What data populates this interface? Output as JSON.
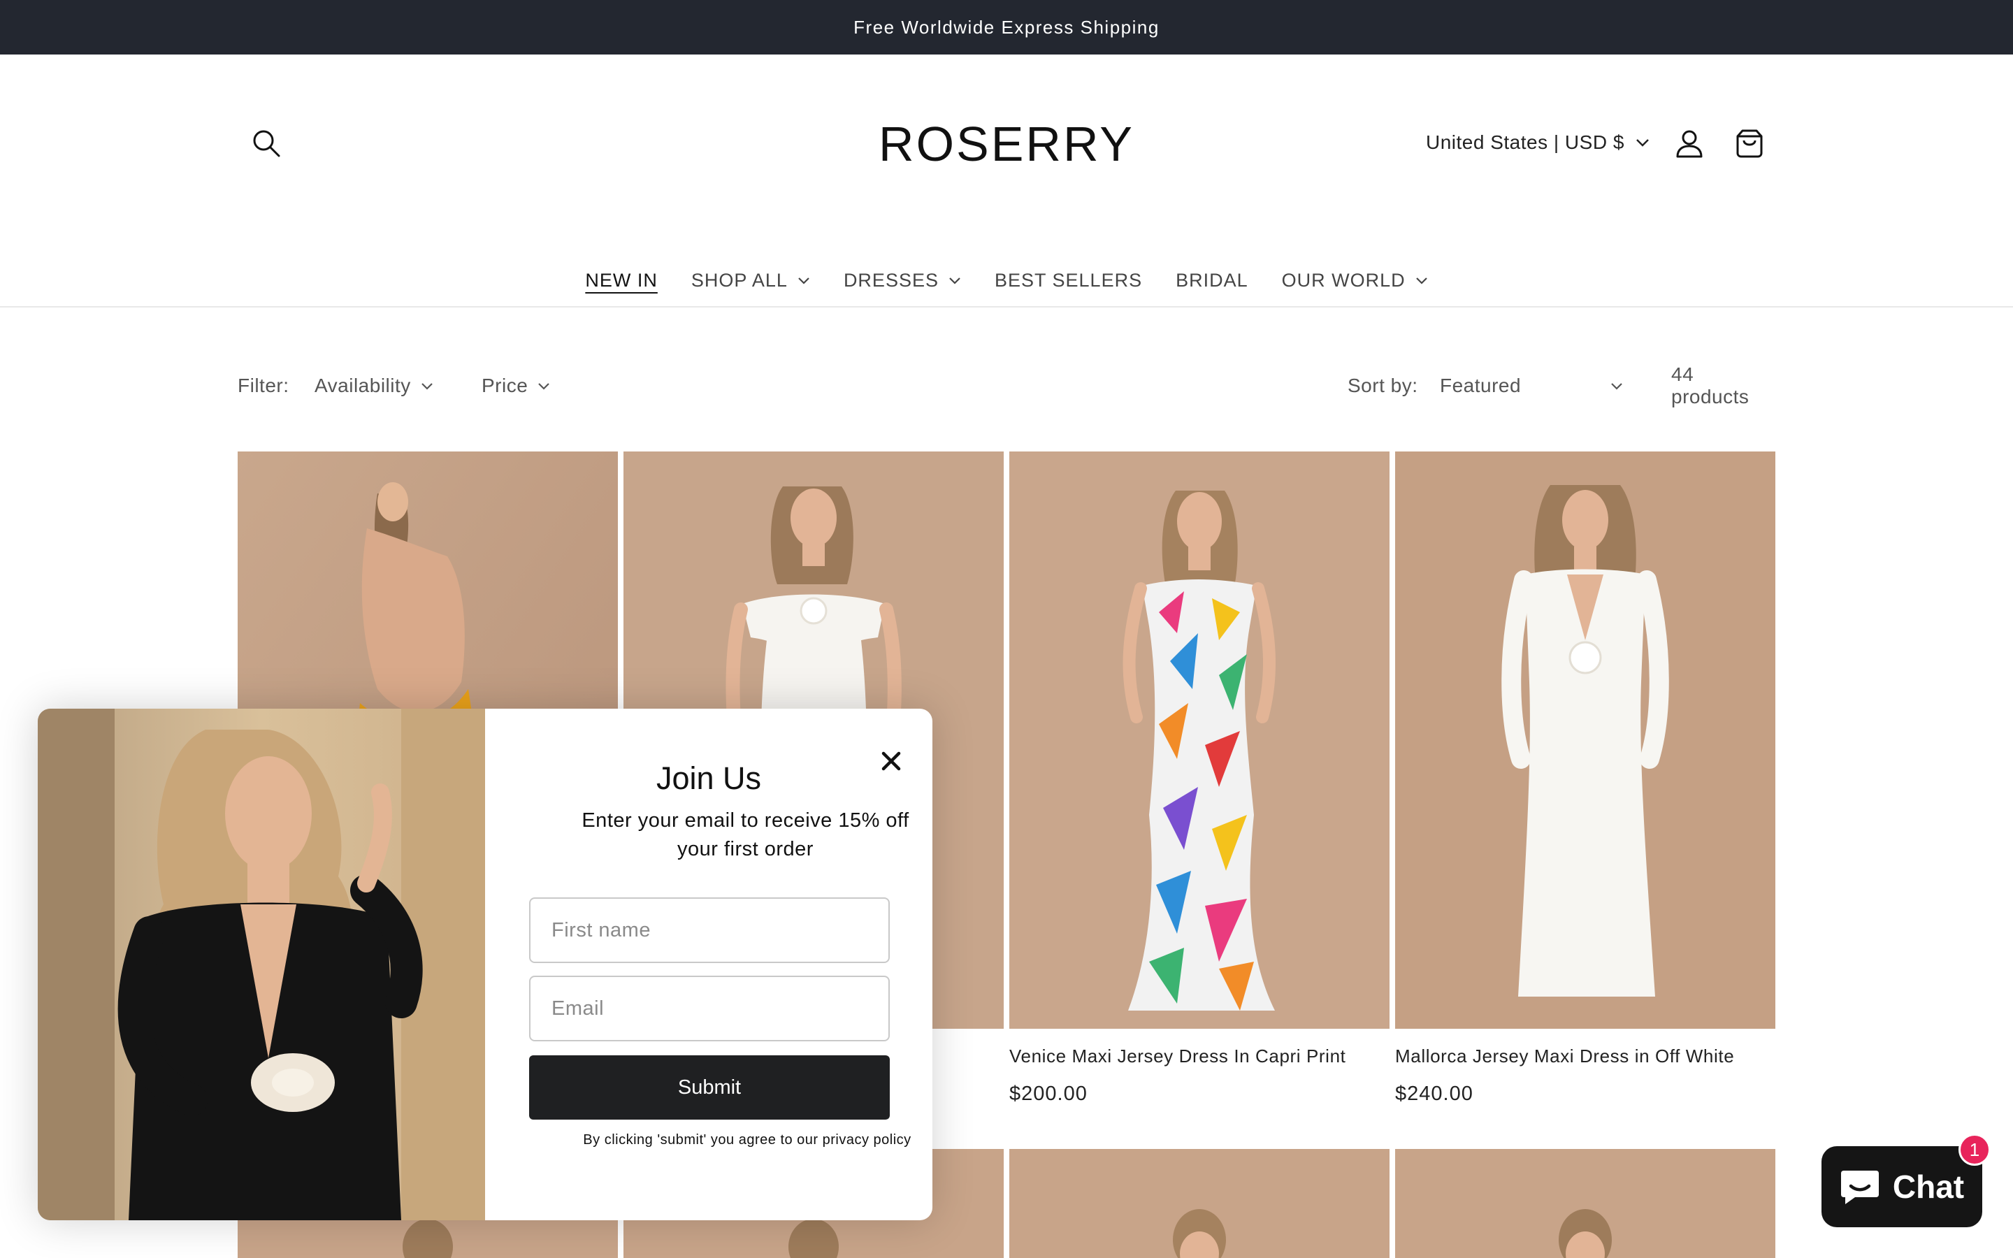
{
  "announcement": "Free Worldwide Express Shipping",
  "header": {
    "logo": "ROSERRY",
    "locale": "United States | USD $"
  },
  "nav": [
    {
      "label": "NEW IN",
      "dropdown": false
    },
    {
      "label": "SHOP ALL",
      "dropdown": true
    },
    {
      "label": "DRESSES",
      "dropdown": true
    },
    {
      "label": "BEST SELLERS",
      "dropdown": false
    },
    {
      "label": "BRIDAL",
      "dropdown": false
    },
    {
      "label": "OUR WORLD",
      "dropdown": true
    }
  ],
  "filters": {
    "label": "Filter:",
    "availability": "Availability",
    "price": "Price",
    "sort_label": "Sort by:",
    "sort_value": "Featured",
    "count": "44 products"
  },
  "products": [
    {
      "title": "",
      "price": "",
      "dress_color": "#e9a11a"
    },
    {
      "title": "",
      "price": "",
      "dress_color": "#f6f4f0"
    },
    {
      "title": "Venice Maxi Jersey Dress In Capri Print",
      "price": "$200.00",
      "dress_color": "#f2f2f2"
    },
    {
      "title": "Mallorca Jersey Maxi Dress in Off White",
      "price": "$240.00",
      "dress_color": "#f7f6f2"
    }
  ],
  "popup": {
    "title": "Join Us",
    "subtitle": "Enter your email to receive 15% off your first order",
    "first_name_placeholder": "First name",
    "email_placeholder": "Email",
    "submit": "Submit",
    "legal": "By clicking 'submit' you agree to our privacy policy"
  },
  "chat": {
    "label": "Chat",
    "badge": "1"
  },
  "colors": {
    "announcement_bg": "#232730",
    "backdrop": "#c8a489",
    "chat_badge": "#e8245b"
  }
}
